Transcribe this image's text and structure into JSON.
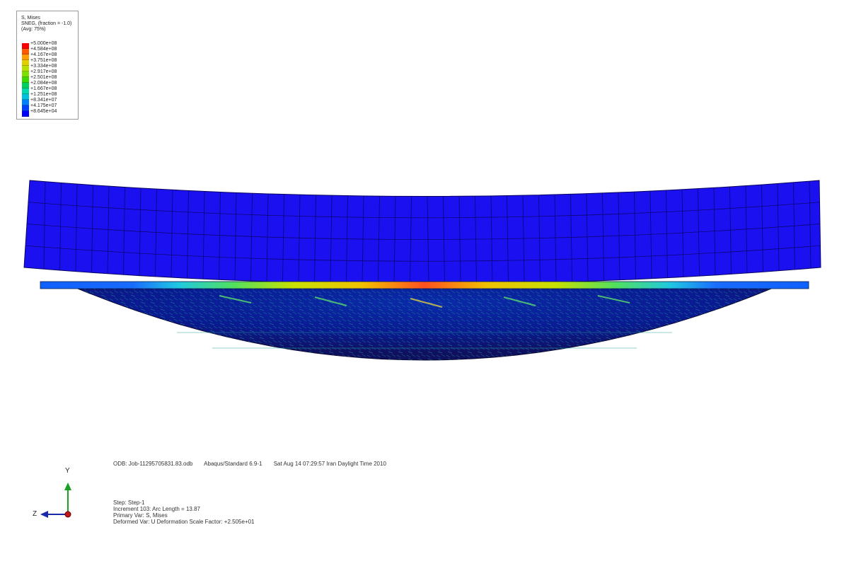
{
  "legend": {
    "title_line1": "S, Mises",
    "title_line2": "SNEG, (fraction = -1.0)",
    "title_line3": "(Avg: 75%)",
    "values": [
      "+5.000e+08",
      "+4.584e+08",
      "+4.167e+08",
      "+3.751e+08",
      "+3.334e+08",
      "+2.917e+08",
      "+2.501e+08",
      "+2.084e+08",
      "+1.667e+08",
      "+1.251e+08",
      "+8.341e+07",
      "+4.175e+07",
      "+8.645e+04"
    ],
    "colors": [
      "#ff0000",
      "#ff5a00",
      "#ffa000",
      "#e0d000",
      "#b8e000",
      "#7ce000",
      "#3cd800",
      "#00d060",
      "#00d8b0",
      "#00c0e0",
      "#0080ff",
      "#0040ff",
      "#0000ff"
    ]
  },
  "info": {
    "odb_line": "ODB: Job-11295705831.83.odb",
    "solver": "Abaqus/Standard 6.9-1",
    "date": "Sat Aug 14 07:29:57 Iran Daylight Time 2010",
    "step": "Step: Step-1",
    "increment": "Increment    103: Arc Length =    13.87",
    "primary_var": "Primary Var: S, Mises",
    "deformed_var": "Deformed Var: U   Deformation Scale Factor: +2.505e+01"
  },
  "triad": {
    "y_label": "Y",
    "z_label": "Z"
  },
  "colors": {
    "beam": "#1a10f0",
    "beam_dark": "#0c08b8",
    "mesh_line": "#0a0660"
  }
}
